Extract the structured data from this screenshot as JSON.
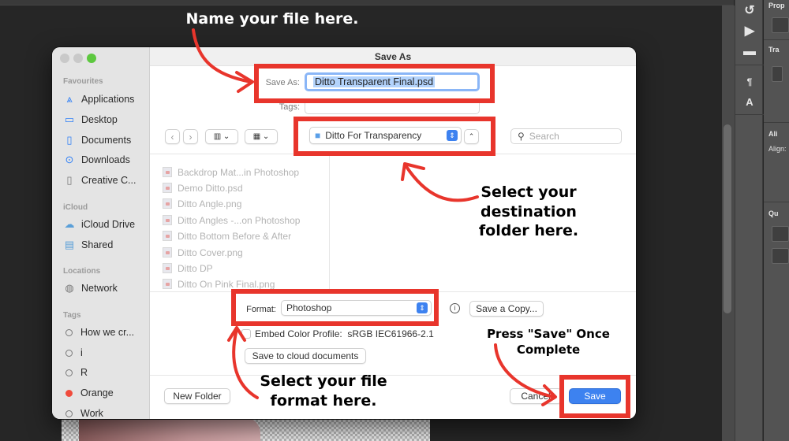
{
  "photoshop": {
    "panel_title": "Prop",
    "panel_sections": [
      "Tra",
      "Ali",
      "Align:",
      "Qu"
    ],
    "tools": [
      "history-icon",
      "play-icon",
      "comment-icon",
      "paragraph-style-icon",
      "character-style-icon"
    ]
  },
  "dialog": {
    "title": "Save As",
    "save_as_label": "Save As:",
    "save_as_value": "Ditto Transparent Final.psd",
    "tags_label": "Tags:",
    "tags_value": "",
    "location": "Ditto For Transparency",
    "search_placeholder": "Search",
    "format_label": "Format:",
    "format_value": "Photoshop",
    "save_copy_label": "Save a Copy...",
    "embed_profile_label": "Embed Color Profile:",
    "embed_profile_value": "sRGB IEC61966-2.1",
    "embed_profile_checked": false,
    "cloud_label": "Save to cloud documents",
    "new_folder_label": "New Folder",
    "cancel_label": "Cancel",
    "save_label": "Save"
  },
  "sidebar": {
    "sections": [
      {
        "title": "Favourites",
        "items": [
          {
            "label": "Applications",
            "icon": "applications-icon"
          },
          {
            "label": "Desktop",
            "icon": "desktop-icon"
          },
          {
            "label": "Documents",
            "icon": "documents-icon"
          },
          {
            "label": "Downloads",
            "icon": "downloads-icon"
          },
          {
            "label": "Creative C...",
            "icon": "file-icon"
          }
        ]
      },
      {
        "title": "iCloud",
        "items": [
          {
            "label": "iCloud Drive",
            "icon": "cloud-icon"
          },
          {
            "label": "Shared",
            "icon": "shared-folder-icon"
          }
        ]
      },
      {
        "title": "Locations",
        "items": [
          {
            "label": "Network",
            "icon": "globe-icon"
          }
        ]
      },
      {
        "title": "Tags",
        "items": [
          {
            "label": "How we cr...",
            "color": "none"
          },
          {
            "label": "i",
            "color": "none"
          },
          {
            "label": "R",
            "color": "none"
          },
          {
            "label": "Orange",
            "color": "#f04b3c"
          },
          {
            "label": "Work",
            "color": "none"
          }
        ]
      }
    ]
  },
  "files": [
    "Backdrop Mat...in Photoshop",
    "Demo Ditto.psd",
    "Ditto Angle.png",
    "Ditto Angles -...on Photoshop",
    "Ditto Bottom Before & After",
    "Ditto Cover.png",
    "Ditto DP",
    "Ditto On Pink Final.png"
  ],
  "annotations": {
    "name_file": "Name your file here.",
    "destination_1": "Select your",
    "destination_2": "destination",
    "destination_3": "folder here.",
    "press_save_1": "Press \"Save\" Once",
    "press_save_2": "Complete",
    "format_1": "Select your file",
    "format_2": "format here.",
    "highlight_color": "#e8352c"
  }
}
